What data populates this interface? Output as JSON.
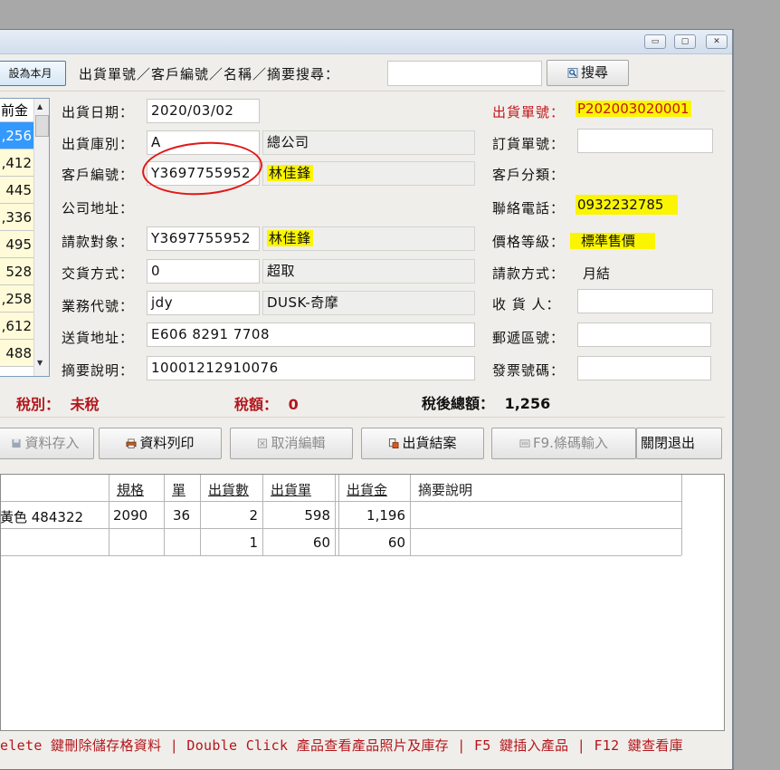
{
  "window": {
    "min_glyph": "▭",
    "max_glyph": "▢",
    "close_glyph": "✕"
  },
  "toolbar": {
    "set_month_label": "設為本月",
    "search_label": "出貨單號／客戶編號／名稱／摘要搜尋：",
    "search_value": "",
    "search_button": "搜尋"
  },
  "left_grid": {
    "header": "前金",
    "values": [
      ",256",
      ",412",
      "445",
      ",336",
      "495",
      "528",
      ",258",
      ",612",
      "488"
    ]
  },
  "form": {
    "ship_date_label": "出貨日期：",
    "ship_date": "2020/03/02",
    "warehouse_label": "出貨庫別：",
    "warehouse_code": "A",
    "warehouse_name": "總公司",
    "customer_id_label": "客戶編號：",
    "customer_id": "Y3697755952",
    "customer_name": "林佳鋒",
    "address_label": "公司地址：",
    "billing_label": "請款對象：",
    "billing_id": "Y3697755952",
    "billing_name": "林佳鋒",
    "delivery_method_label": "交貨方式：",
    "delivery_code": "0",
    "delivery_name": "超取",
    "sales_label": "業務代號：",
    "sales_code": "jdy",
    "sales_name": "DUSK-奇摩",
    "ship_address_label": "送貨地址：",
    "ship_address": "E606 8291 7708",
    "memo_label": "摘要說明：",
    "memo": "10001212910076",
    "order_no_label": "出貨單號：",
    "order_no": "P202003020001",
    "purchase_no_label": "訂貨單號：",
    "purchase_no": "",
    "customer_class_label": "客戶分類：",
    "phone_label": "聯絡電話：",
    "phone": "0932232785",
    "price_level_label": "價格等級：",
    "price_level": "標準售價",
    "payment_label": "請款方式：",
    "payment": "月結",
    "receiver_label": "收 貨 人：",
    "receiver": "",
    "postal_label": "郵遞區號：",
    "postal": "",
    "invoice_label": "發票號碼：",
    "invoice": ""
  },
  "totals": {
    "tax_type_label": "稅別：",
    "tax_type": "未稅",
    "tax_amount_label": "稅額：",
    "tax_amount": "0",
    "total_label": "稅後總額：",
    "total": "1,256"
  },
  "buttons": {
    "save": "資料存入",
    "print": "資料列印",
    "cancel": "取消編輯",
    "close_order": "出貨結案",
    "barcode": "F9.條碼輸入",
    "exit": "關閉退出"
  },
  "table": {
    "headers": [
      "規格",
      "單",
      "出貨數",
      "出貨單",
      "出貨金",
      "摘要說明"
    ],
    "rows": [
      {
        "name": "黃色 484322",
        "spec": "2090",
        "unit": "36",
        "qty": "2",
        "price": "598",
        "amount": "1,196",
        "memo": ""
      },
      {
        "name": "",
        "spec": "",
        "unit": "",
        "qty": "1",
        "price": "60",
        "amount": "60",
        "memo": ""
      }
    ]
  },
  "status_bar": "elete 鍵刪除儲存格資料 | Double Click 產品查看產品照片及庫存 | F5 鍵插入產品 | F12 鍵查看庫"
}
